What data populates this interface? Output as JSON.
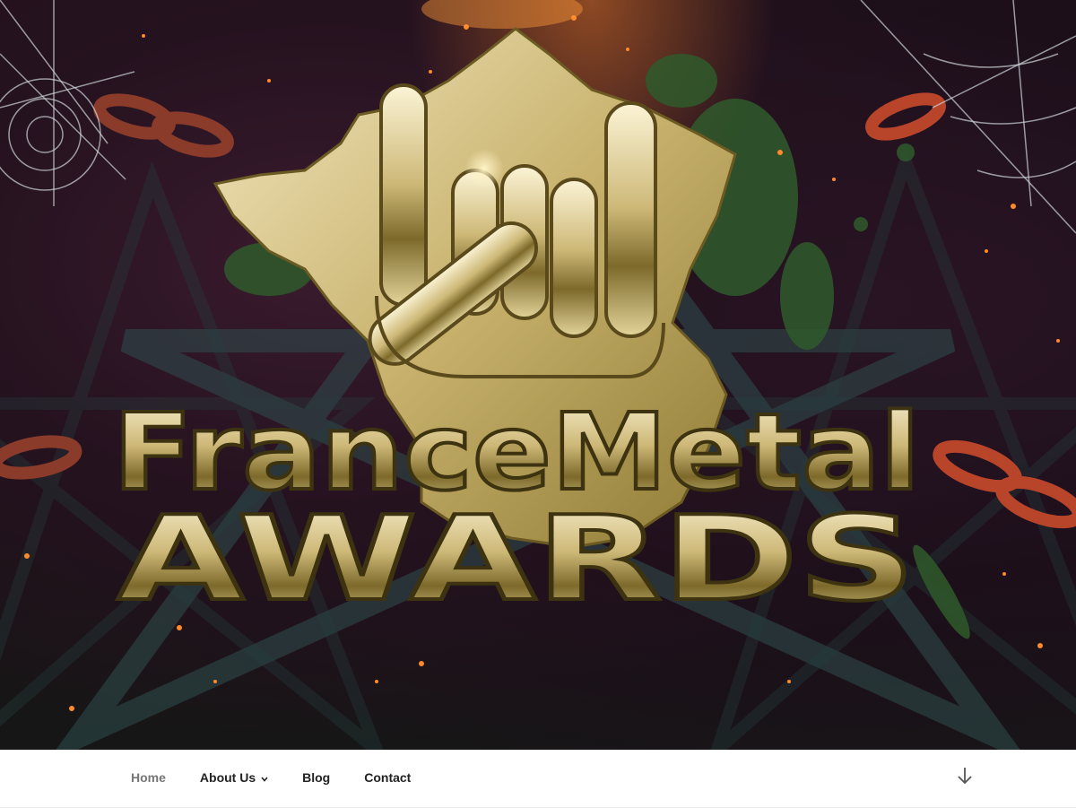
{
  "header": {
    "logo": {
      "line1": "FranceMetal",
      "line2": "AWARDS"
    }
  },
  "nav": {
    "items": [
      {
        "label": "Home",
        "current": true
      },
      {
        "label": "About Us",
        "has_submenu": true,
        "icon": "chevron-down-icon"
      },
      {
        "label": "Blog"
      },
      {
        "label": "Contact"
      }
    ],
    "scroll_icon": "arrow-down-icon"
  },
  "colors": {
    "gold": "#d9c58a",
    "gold_dark": "#6b5a22",
    "nav_text": "#222222",
    "nav_current": "#767676"
  }
}
